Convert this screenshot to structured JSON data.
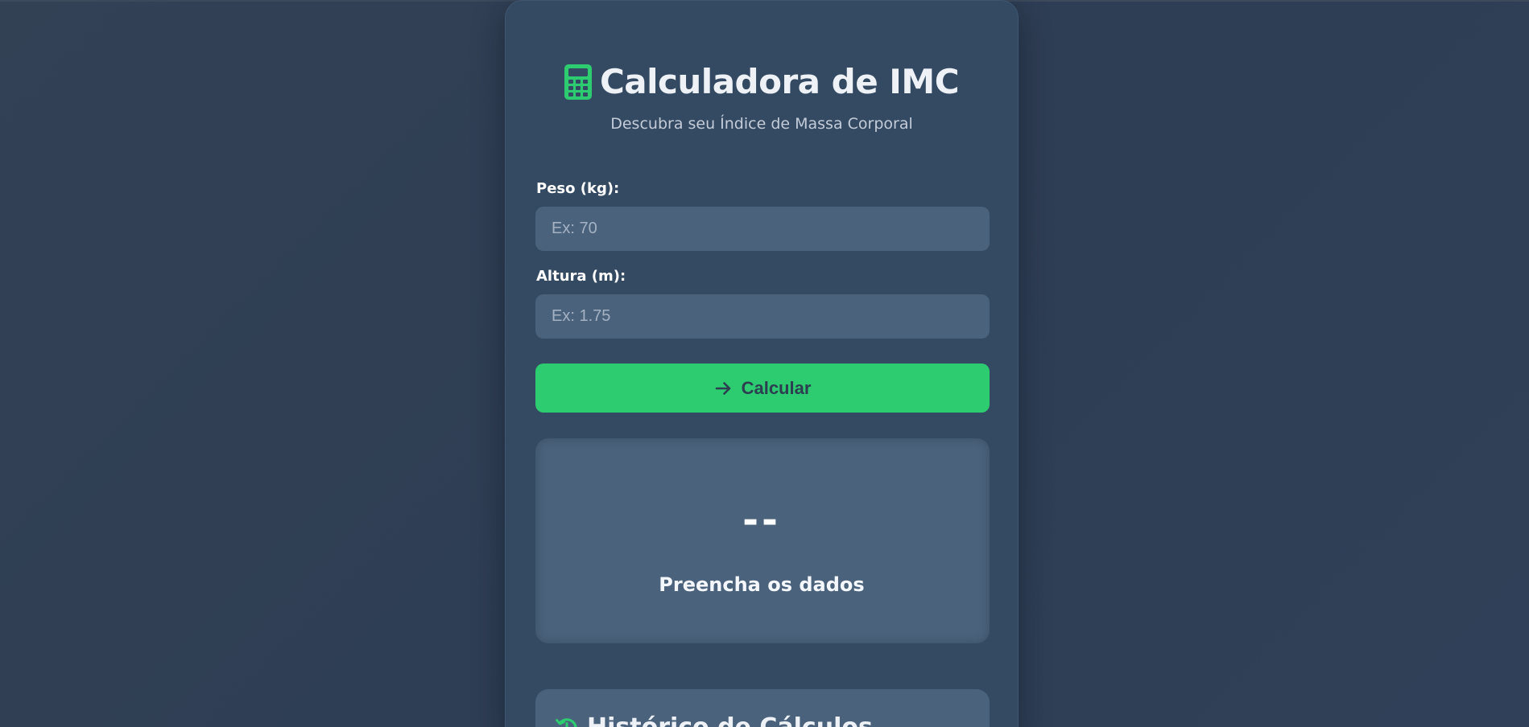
{
  "app": {
    "title": "Calculadora de IMC",
    "subtitle": "Descubra seu Índice de Massa Corporal",
    "title_icon": "calculator-icon"
  },
  "form": {
    "weight": {
      "label": "Peso (kg):",
      "placeholder": "Ex: 70",
      "value": ""
    },
    "height": {
      "label": "Altura (m):",
      "placeholder": "Ex: 1.75",
      "value": ""
    },
    "calculate_button": {
      "label": "Calcular",
      "icon": "arrow-right-icon"
    }
  },
  "result": {
    "value": "--",
    "message": "Preencha os dados"
  },
  "history": {
    "title": "Histórico de Cálculos",
    "icon": "history-icon"
  },
  "colors": {
    "background": "#2f4058",
    "card": "#344a62",
    "input": "#4b627c",
    "accent": "#2ecc71",
    "button_text": "#2c3e50",
    "text": "#eef2f7",
    "muted_text": "#c3ccd8"
  }
}
